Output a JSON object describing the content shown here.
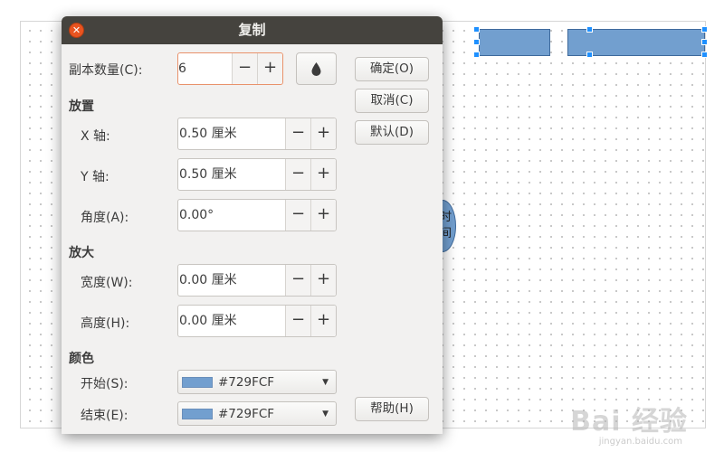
{
  "dialog": {
    "title": "复制",
    "close_glyph": "✕"
  },
  "copies": {
    "label": "副本数量(C):",
    "value": "6",
    "minus": "−",
    "plus": "+"
  },
  "placement": {
    "section": "放置",
    "x_axis": {
      "label": "X 轴:",
      "value": "0.50 厘米"
    },
    "y_axis": {
      "label": "Y 轴:",
      "value": "0.50 厘米"
    },
    "angle": {
      "label": "角度(A):",
      "value": "0.00°"
    }
  },
  "enlargement": {
    "section": "放大",
    "width": {
      "label": "宽度(W):",
      "value": "0.00 厘米"
    },
    "height": {
      "label": "高度(H):",
      "value": "0.00 厘米"
    }
  },
  "colors": {
    "section": "颜色",
    "start": {
      "label": "开始(S):",
      "value": "#729FCF",
      "swatch": "#729FCF"
    },
    "end": {
      "label": "结束(E):",
      "value": "#729FCF",
      "swatch": "#729FCF"
    }
  },
  "buttons": {
    "ok": "确定(O)",
    "cancel": "取消(C)",
    "default": "默认(D)",
    "help": "帮助(H)"
  },
  "spin_controls": {
    "minus": "−",
    "plus": "+"
  },
  "background": {
    "ellipse_text": "时\n间",
    "watermark": "Bai 经验",
    "watermark_sub": "jingyan.baidu.com"
  },
  "icons": {
    "close": "close-icon",
    "dropper": "color-dropper-icon",
    "combo_arrow": "chevron-down-icon"
  }
}
